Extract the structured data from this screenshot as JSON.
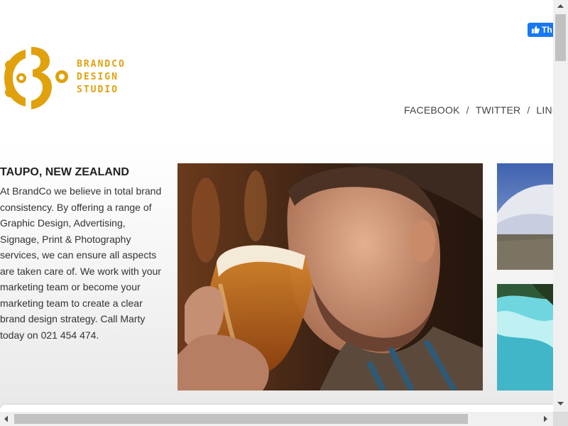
{
  "facebook_like": {
    "label": "Th"
  },
  "logo": {
    "line1": "BRANDCO",
    "line2": "DESIGN",
    "line3": "STUDIO"
  },
  "social_nav": {
    "items": [
      "FACEBOOK",
      "TWITTER",
      "LINK"
    ],
    "separator": "/"
  },
  "intro": {
    "heading": "TAUPO, NEW ZEALAND",
    "text": "At BrandCo we believe in total brand consistency. By offering a range of Graphic Design, Advertising, Signage, Print & Photography services, we can ensure all aspects are taken care of. We work with your marketing team or become your marketing team to create a clear brand design strategy. Call Marty today on 021 454 474."
  },
  "colors": {
    "brand": "#e0a10d",
    "facebook": "#1877f2"
  },
  "icons": [
    "facebook-thumb-icon",
    "brandco-logo-icon",
    "scroll-up-icon",
    "scroll-down-icon",
    "scroll-left-icon",
    "scroll-right-icon"
  ]
}
